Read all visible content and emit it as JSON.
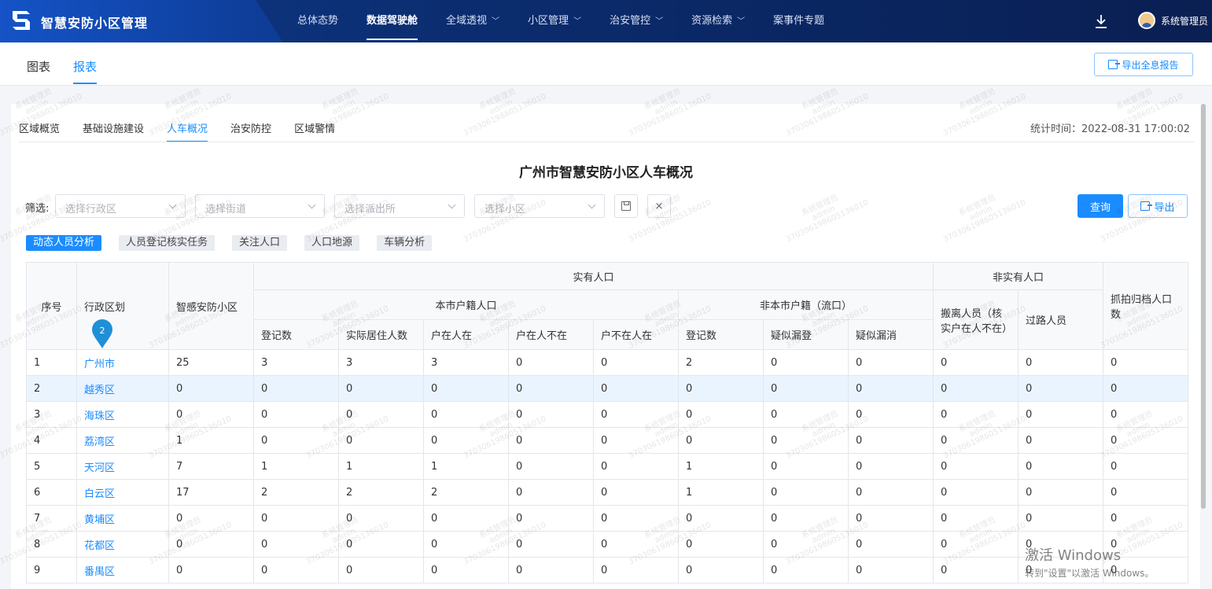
{
  "app": {
    "title": "智慧安防小区管理"
  },
  "nav": {
    "items": [
      {
        "label": "总体态势",
        "dropdown": false,
        "active": false
      },
      {
        "label": "数据驾驶舱",
        "dropdown": false,
        "active": true
      },
      {
        "label": "全域透视",
        "dropdown": true,
        "active": false
      },
      {
        "label": "小区管理",
        "dropdown": true,
        "active": false
      },
      {
        "label": "治安管控",
        "dropdown": true,
        "active": false
      },
      {
        "label": "资源检索",
        "dropdown": true,
        "active": false
      },
      {
        "label": "案事件专题",
        "dropdown": false,
        "active": false
      }
    ],
    "user_name": "系统管理员"
  },
  "subtabs": {
    "chart": "图表",
    "report": "报表",
    "export_all": "导出全息报告"
  },
  "report_tabs": [
    "区域概览",
    "基础设施建设",
    "人车概况",
    "治安防控",
    "区域警情"
  ],
  "active_report_tab": 2,
  "stat_time": "统计时间：2022-08-31 17:00:02",
  "report_title": "广州市智慧安防小区人车概况",
  "filter": {
    "label": "筛选:",
    "district_placeholder": "选择行政区",
    "street_placeholder": "选择街道",
    "station_placeholder": "选择派出所",
    "community_placeholder": "选择小区",
    "clear_glyph": "×",
    "query": "查询",
    "export": "导出"
  },
  "chips": [
    "动态人员分析",
    "人员登记核实任务",
    "关注人口",
    "人口地源",
    "车辆分析"
  ],
  "active_chip": 0,
  "table": {
    "headers": {
      "seq": "序号",
      "district": "行政区划",
      "community": "智感安防小区",
      "actual": "实有人口",
      "local": "本市户籍人口",
      "nonlocal": "非本市户籍（流口）",
      "non_actual": "非实有人口",
      "captured": "抓拍归档人口数",
      "registered": "登记数",
      "actual_resident": "实际居住人数",
      "hh_present": "户在人在",
      "hh_absent_person": "户在人不在",
      "no_hh_person": "户不在人在",
      "nl_registered": "登记数",
      "suspect_missed": "疑似漏登",
      "suspect_cancel": "疑似漏消",
      "moved_out": "搬离人员（核实户在人不在）",
      "passers": "过路人员"
    },
    "rows": [
      [
        "1",
        "广州市",
        "25",
        "3",
        "3",
        "3",
        "0",
        "0",
        "2",
        "0",
        "0",
        "0",
        "0",
        "0"
      ],
      [
        "2",
        "越秀区",
        "0",
        "0",
        "0",
        "0",
        "0",
        "0",
        "0",
        "0",
        "0",
        "0",
        "0",
        "0"
      ],
      [
        "3",
        "海珠区",
        "0",
        "0",
        "0",
        "0",
        "0",
        "0",
        "0",
        "0",
        "0",
        "0",
        "0",
        "0"
      ],
      [
        "4",
        "荔湾区",
        "1",
        "0",
        "0",
        "0",
        "0",
        "0",
        "0",
        "0",
        "0",
        "0",
        "0",
        "0"
      ],
      [
        "5",
        "天河区",
        "7",
        "1",
        "1",
        "1",
        "0",
        "0",
        "1",
        "0",
        "0",
        "0",
        "0",
        "0"
      ],
      [
        "6",
        "白云区",
        "17",
        "2",
        "2",
        "2",
        "0",
        "0",
        "1",
        "0",
        "0",
        "0",
        "0",
        "0"
      ],
      [
        "7",
        "黄埔区",
        "0",
        "0",
        "0",
        "0",
        "0",
        "0",
        "0",
        "0",
        "0",
        "0",
        "0",
        "0"
      ],
      [
        "8",
        "花都区",
        "0",
        "0",
        "0",
        "0",
        "0",
        "0",
        "0",
        "0",
        "0",
        "0",
        "0",
        "0"
      ],
      [
        "9",
        "番禺区",
        "0",
        "0",
        "0",
        "0",
        "0",
        "0",
        "0",
        "0",
        "0",
        "0",
        "0",
        "0"
      ]
    ],
    "highlight_row": 1
  },
  "marker": {
    "number": "2"
  },
  "watermark": {
    "name": "系统管理员",
    "user": "admin",
    "id": "370306198605136010"
  },
  "activation": {
    "title": "激活 Windows",
    "subtitle": "转到\"设置\"以激活 Windows。"
  }
}
